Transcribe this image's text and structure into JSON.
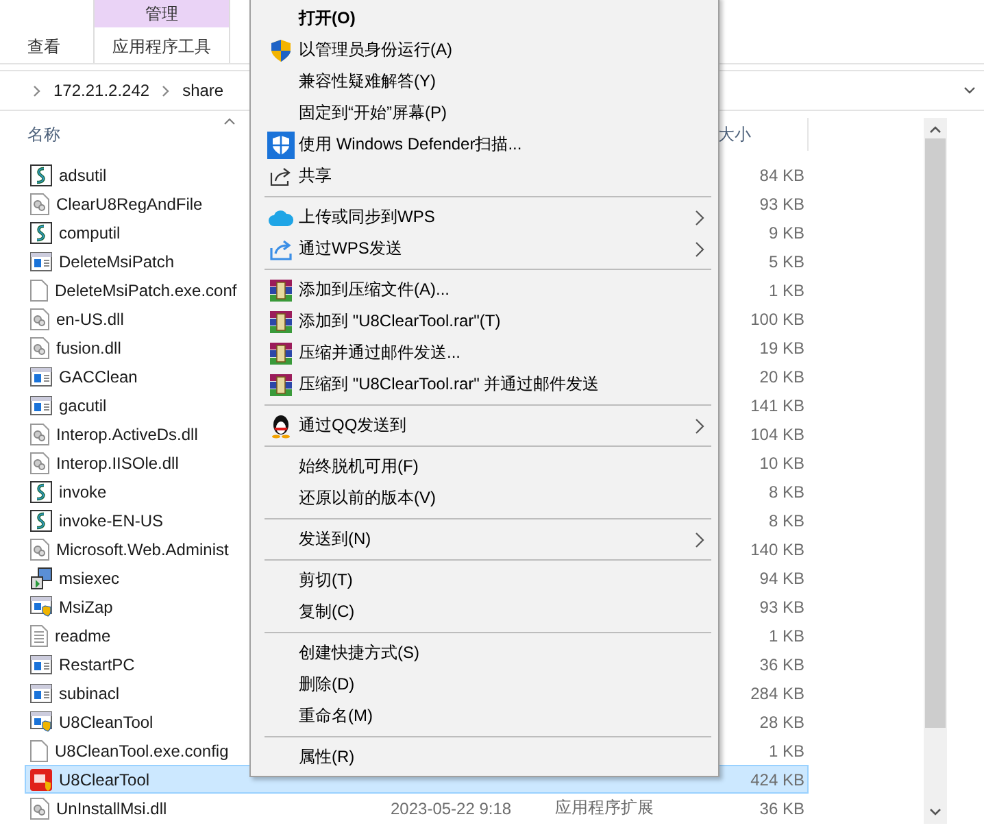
{
  "ribbon": {
    "tabs": [
      {
        "label": "查看",
        "selected": false
      }
    ],
    "context_group": {
      "header": "管理",
      "tabs": [
        {
          "label": "应用程序工具",
          "selected": false
        }
      ]
    }
  },
  "address_bar": {
    "path": [
      "172.21.2.242",
      "share"
    ]
  },
  "columns": [
    {
      "label": "名称"
    },
    {
      "label": "大小"
    }
  ],
  "files": [
    {
      "name": "adsutil",
      "kind": "script",
      "size": "84 KB",
      "selected": false
    },
    {
      "name": "ClearU8RegAndFile",
      "kind": "dll",
      "size": "93 KB",
      "selected": false
    },
    {
      "name": "computil",
      "kind": "script",
      "size": "9 KB",
      "selected": false
    },
    {
      "name": "DeleteMsiPatch",
      "kind": "app",
      "size": "5 KB",
      "selected": false
    },
    {
      "name": "DeleteMsiPatch.exe.conf",
      "kind": "blank",
      "size": "1 KB",
      "selected": false
    },
    {
      "name": "en-US.dll",
      "kind": "dll",
      "size": "100 KB",
      "selected": false
    },
    {
      "name": "fusion.dll",
      "kind": "dll",
      "size": "19 KB",
      "selected": false
    },
    {
      "name": "GACClean",
      "kind": "app",
      "size": "20 KB",
      "selected": false
    },
    {
      "name": "gacutil",
      "kind": "app",
      "size": "141 KB",
      "selected": false
    },
    {
      "name": "Interop.ActiveDs.dll",
      "kind": "dll",
      "size": "104 KB",
      "selected": false
    },
    {
      "name": "Interop.IISOle.dll",
      "kind": "dll",
      "size": "10 KB",
      "selected": false
    },
    {
      "name": "invoke",
      "kind": "script",
      "size": "8 KB",
      "selected": false
    },
    {
      "name": "invoke-EN-US",
      "kind": "script",
      "size": "8 KB",
      "selected": false
    },
    {
      "name": "Microsoft.Web.Administ",
      "kind": "dll",
      "size": "140 KB",
      "selected": false
    },
    {
      "name": "msiexec",
      "kind": "installer",
      "size": "94 KB",
      "selected": false
    },
    {
      "name": "MsiZap",
      "kind": "shield-app",
      "size": "93 KB",
      "selected": false
    },
    {
      "name": "readme",
      "kind": "text",
      "size": "1 KB",
      "selected": false
    },
    {
      "name": "RestartPC",
      "kind": "app",
      "size": "36 KB",
      "selected": false
    },
    {
      "name": "subinacl",
      "kind": "app",
      "size": "284 KB",
      "selected": false
    },
    {
      "name": "U8CleanTool",
      "kind": "shield-app",
      "size": "28 KB",
      "selected": false
    },
    {
      "name": "U8CleanTool.exe.config",
      "kind": "blank",
      "size": "1 KB",
      "selected": false
    },
    {
      "name": "U8ClearTool",
      "kind": "u8",
      "size": "424 KB",
      "selected": true
    },
    {
      "name": "UnInstallMsi.dll",
      "kind": "dll",
      "date": "2023-05-22 9:18",
      "type": "应用程序扩展",
      "size": "36 KB",
      "selected": false
    }
  ],
  "context_menu": {
    "items": [
      {
        "kind": "plain",
        "label": "打开(O)",
        "default": true,
        "submenu": false
      },
      {
        "kind": "uac",
        "label": "以管理员身份运行(A)",
        "default": false,
        "submenu": false
      },
      {
        "kind": "plain",
        "label": "兼容性疑难解答(Y)",
        "default": false,
        "submenu": false
      },
      {
        "kind": "plain",
        "label": "固定到“开始”屏幕(P)",
        "default": false,
        "submenu": false
      },
      {
        "kind": "defender",
        "label": "使用 Windows Defender扫描...",
        "default": false,
        "submenu": false
      },
      {
        "kind": "share",
        "label": "共享",
        "default": false,
        "submenu": false
      },
      {
        "kind": "separator"
      },
      {
        "kind": "cloud",
        "label": "上传或同步到WPS",
        "default": false,
        "submenu": true
      },
      {
        "kind": "send",
        "label": "通过WPS发送",
        "default": false,
        "submenu": true
      },
      {
        "kind": "separator"
      },
      {
        "kind": "rar",
        "label": "添加到压缩文件(A)...",
        "default": false,
        "submenu": false
      },
      {
        "kind": "rar",
        "label": "添加到 \"U8ClearTool.rar\"(T)",
        "default": false,
        "submenu": false
      },
      {
        "kind": "rar",
        "label": "压缩并通过邮件发送...",
        "default": false,
        "submenu": false
      },
      {
        "kind": "rar",
        "label": "压缩到 \"U8ClearTool.rar\" 并通过邮件发送",
        "default": false,
        "submenu": false
      },
      {
        "kind": "separator"
      },
      {
        "kind": "penguin",
        "label": "通过QQ发送到",
        "default": false,
        "submenu": true
      },
      {
        "kind": "separator"
      },
      {
        "kind": "plain",
        "label": "始终脱机可用(F)",
        "default": false,
        "submenu": false
      },
      {
        "kind": "plain",
        "label": "还原以前的版本(V)",
        "default": false,
        "submenu": false
      },
      {
        "kind": "separator"
      },
      {
        "kind": "plain",
        "label": "发送到(N)",
        "default": false,
        "submenu": true
      },
      {
        "kind": "separator"
      },
      {
        "kind": "plain",
        "label": "剪切(T)",
        "default": false,
        "submenu": false
      },
      {
        "kind": "plain",
        "label": "复制(C)",
        "default": false,
        "submenu": false
      },
      {
        "kind": "separator"
      },
      {
        "kind": "plain",
        "label": "创建快捷方式(S)",
        "default": false,
        "submenu": false
      },
      {
        "kind": "plain",
        "label": "删除(D)",
        "default": false,
        "submenu": false
      },
      {
        "kind": "plain",
        "label": "重命名(M)",
        "default": false,
        "submenu": false
      },
      {
        "kind": "separator"
      },
      {
        "kind": "plain",
        "label": "属性(R)",
        "default": false,
        "submenu": false
      }
    ]
  }
}
